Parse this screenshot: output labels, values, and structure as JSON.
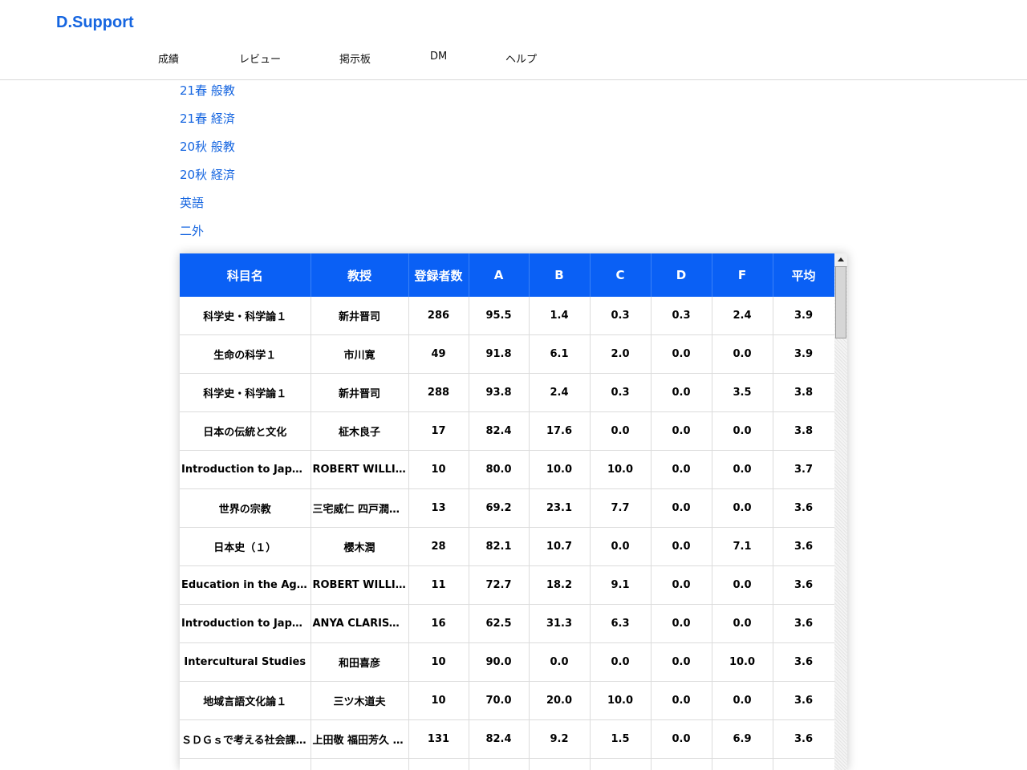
{
  "app": {
    "logo": "D.Support"
  },
  "nav": {
    "items": [
      "成績",
      "レビュー",
      "掲示板",
      "DM",
      "ヘルプ"
    ]
  },
  "sidebar": {
    "links": [
      "21春 般教",
      "21春 経済",
      "20秋 般教",
      "20秋 経済",
      "英語",
      "二外"
    ]
  },
  "table": {
    "headers": [
      "科目名",
      "教授",
      "登録者数",
      "A",
      "B",
      "C",
      "D",
      "F",
      "平均"
    ],
    "rows": [
      [
        "科学史・科学論１",
        "新井晋司",
        "286",
        "95.5",
        "1.4",
        "0.3",
        "0.3",
        "2.4",
        "3.9"
      ],
      [
        "生命の科学１",
        "市川寛",
        "49",
        "91.8",
        "6.1",
        "2.0",
        "0.0",
        "0.0",
        "3.9"
      ],
      [
        "科学史・科学論１",
        "新井晋司",
        "288",
        "93.8",
        "2.4",
        "0.3",
        "0.0",
        "3.5",
        "3.8"
      ],
      [
        "日本の伝統と文化",
        "柾木良子",
        "17",
        "82.4",
        "17.6",
        "0.0",
        "0.0",
        "0.0",
        "3.8"
      ],
      [
        "Introduction to Japanese...",
        "ROBERT WILLIAM...",
        "10",
        "80.0",
        "10.0",
        "10.0",
        "0.0",
        "0.0",
        "3.7"
      ],
      [
        "世界の宗教",
        "三宅威仁 四戸潤弥...",
        "13",
        "69.2",
        "23.1",
        "7.7",
        "0.0",
        "0.0",
        "3.6"
      ],
      [
        "日本史（１）",
        "櫻木潤",
        "28",
        "82.1",
        "10.7",
        "0.0",
        "0.0",
        "7.1",
        "3.6"
      ],
      [
        "Education in the Age of ...",
        "ROBERT WILLIAM...",
        "11",
        "72.7",
        "18.2",
        "9.1",
        "0.0",
        "0.0",
        "3.6"
      ],
      [
        "Introduction to Japanese...",
        "ANYA CLARISSA...",
        "16",
        "62.5",
        "31.3",
        "6.3",
        "0.0",
        "0.0",
        "3.6"
      ],
      [
        "Intercultural Studies",
        "和田喜彦",
        "10",
        "90.0",
        "0.0",
        "0.0",
        "0.0",
        "10.0",
        "3.6"
      ],
      [
        "地域言語文化論１",
        "三ツ木道夫",
        "10",
        "70.0",
        "20.0",
        "10.0",
        "0.0",
        "0.0",
        "3.6"
      ],
      [
        "ＳＤＧｓで考える社会課題...",
        "上田敬 福田芳久 宮...",
        "131",
        "82.4",
        "9.2",
        "1.5",
        "0.0",
        "6.9",
        "3.6"
      ],
      [
        "",
        "",
        "",
        "",
        "",
        "",
        "",
        "",
        ""
      ]
    ]
  }
}
